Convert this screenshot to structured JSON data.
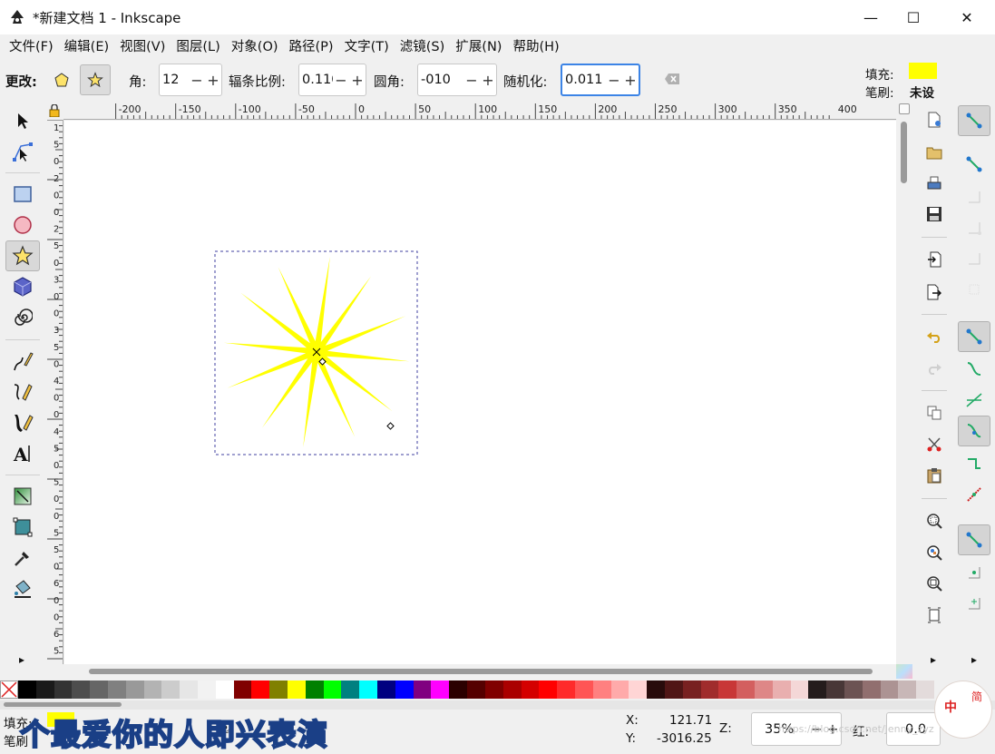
{
  "window": {
    "title": "*新建文档 1 - Inkscape",
    "min": "—",
    "max": "☐",
    "close": "✕"
  },
  "menu": [
    "文件(F)",
    "编辑(E)",
    "视图(V)",
    "图层(L)",
    "对象(O)",
    "路径(P)",
    "文字(T)",
    "滤镜(S)",
    "扩展(N)",
    "帮助(H)"
  ],
  "controls": {
    "change_label": "更改:",
    "corners_label": "角:",
    "corners_value": "12",
    "spoke_label": "辐条比例:",
    "spoke_value": "0.110",
    "round_label": "圆角:",
    "round_value": "-010",
    "random_label": "随机化:",
    "random_value": "0.011",
    "fill_label": "填充:",
    "stroke_label": "笔刷:",
    "stroke_value": "未设",
    "fill_color": "#ffff00"
  },
  "ruler": {
    "h_labels": [
      "-200",
      "-150",
      "-100",
      "-50",
      "0",
      "50",
      "100",
      "150",
      "200",
      "250",
      "300",
      "350",
      "400"
    ],
    "v_labels": [
      "1",
      "5",
      "0",
      "2",
      "0",
      "0",
      "2",
      "5",
      "0",
      "3",
      "0",
      "0",
      "3",
      "5",
      "0",
      "4",
      "0",
      "0",
      "4",
      "5",
      "0",
      "5",
      "0",
      "0",
      "5",
      "5",
      "0",
      "6",
      "0",
      "0",
      "6",
      "5"
    ]
  },
  "star": {
    "points": 12,
    "color": "#ffff00",
    "selection_color": "#3b3bb5"
  },
  "palette_colors": [
    "#000000",
    "#1a1a1a",
    "#333333",
    "#4d4d4d",
    "#666666",
    "#808080",
    "#999999",
    "#b3b3b3",
    "#cccccc",
    "#e6e6e6",
    "#f2f2f2",
    "#ffffff",
    "#800000",
    "#ff0000",
    "#808000",
    "#ffff00",
    "#008000",
    "#00ff00",
    "#008080",
    "#00ffff",
    "#000080",
    "#0000ff",
    "#800080",
    "#ff00ff",
    "#2b0000",
    "#550000",
    "#800000",
    "#aa0000",
    "#d40000",
    "#ff0000",
    "#ff2a2a",
    "#ff5555",
    "#ff8080",
    "#ffaaaa",
    "#ffd5d5",
    "#280b0b",
    "#501616",
    "#782121",
    "#a02c2c",
    "#c83737",
    "#d35f5f",
    "#de8787",
    "#e9afaf",
    "#f4d7d7",
    "#241c1c",
    "#483737",
    "#6c5353",
    "#916f6f",
    "#ac9393",
    "#c8b7b7",
    "#e3dbdb"
  ],
  "status": {
    "fill_label": "填充:",
    "stroke_label": "笔刷",
    "x_label": "X:",
    "x_value": "121.71",
    "y_label": "Y:",
    "y_value": "-3016.25",
    "z_label": "Z:",
    "zoom_value": "35%",
    "r_label": "红:",
    "r_value": "0.0",
    "watermark": "个最爱你的人即兴表演",
    "csdn": "https://blog.csdn.net/Jenny_zyz"
  }
}
